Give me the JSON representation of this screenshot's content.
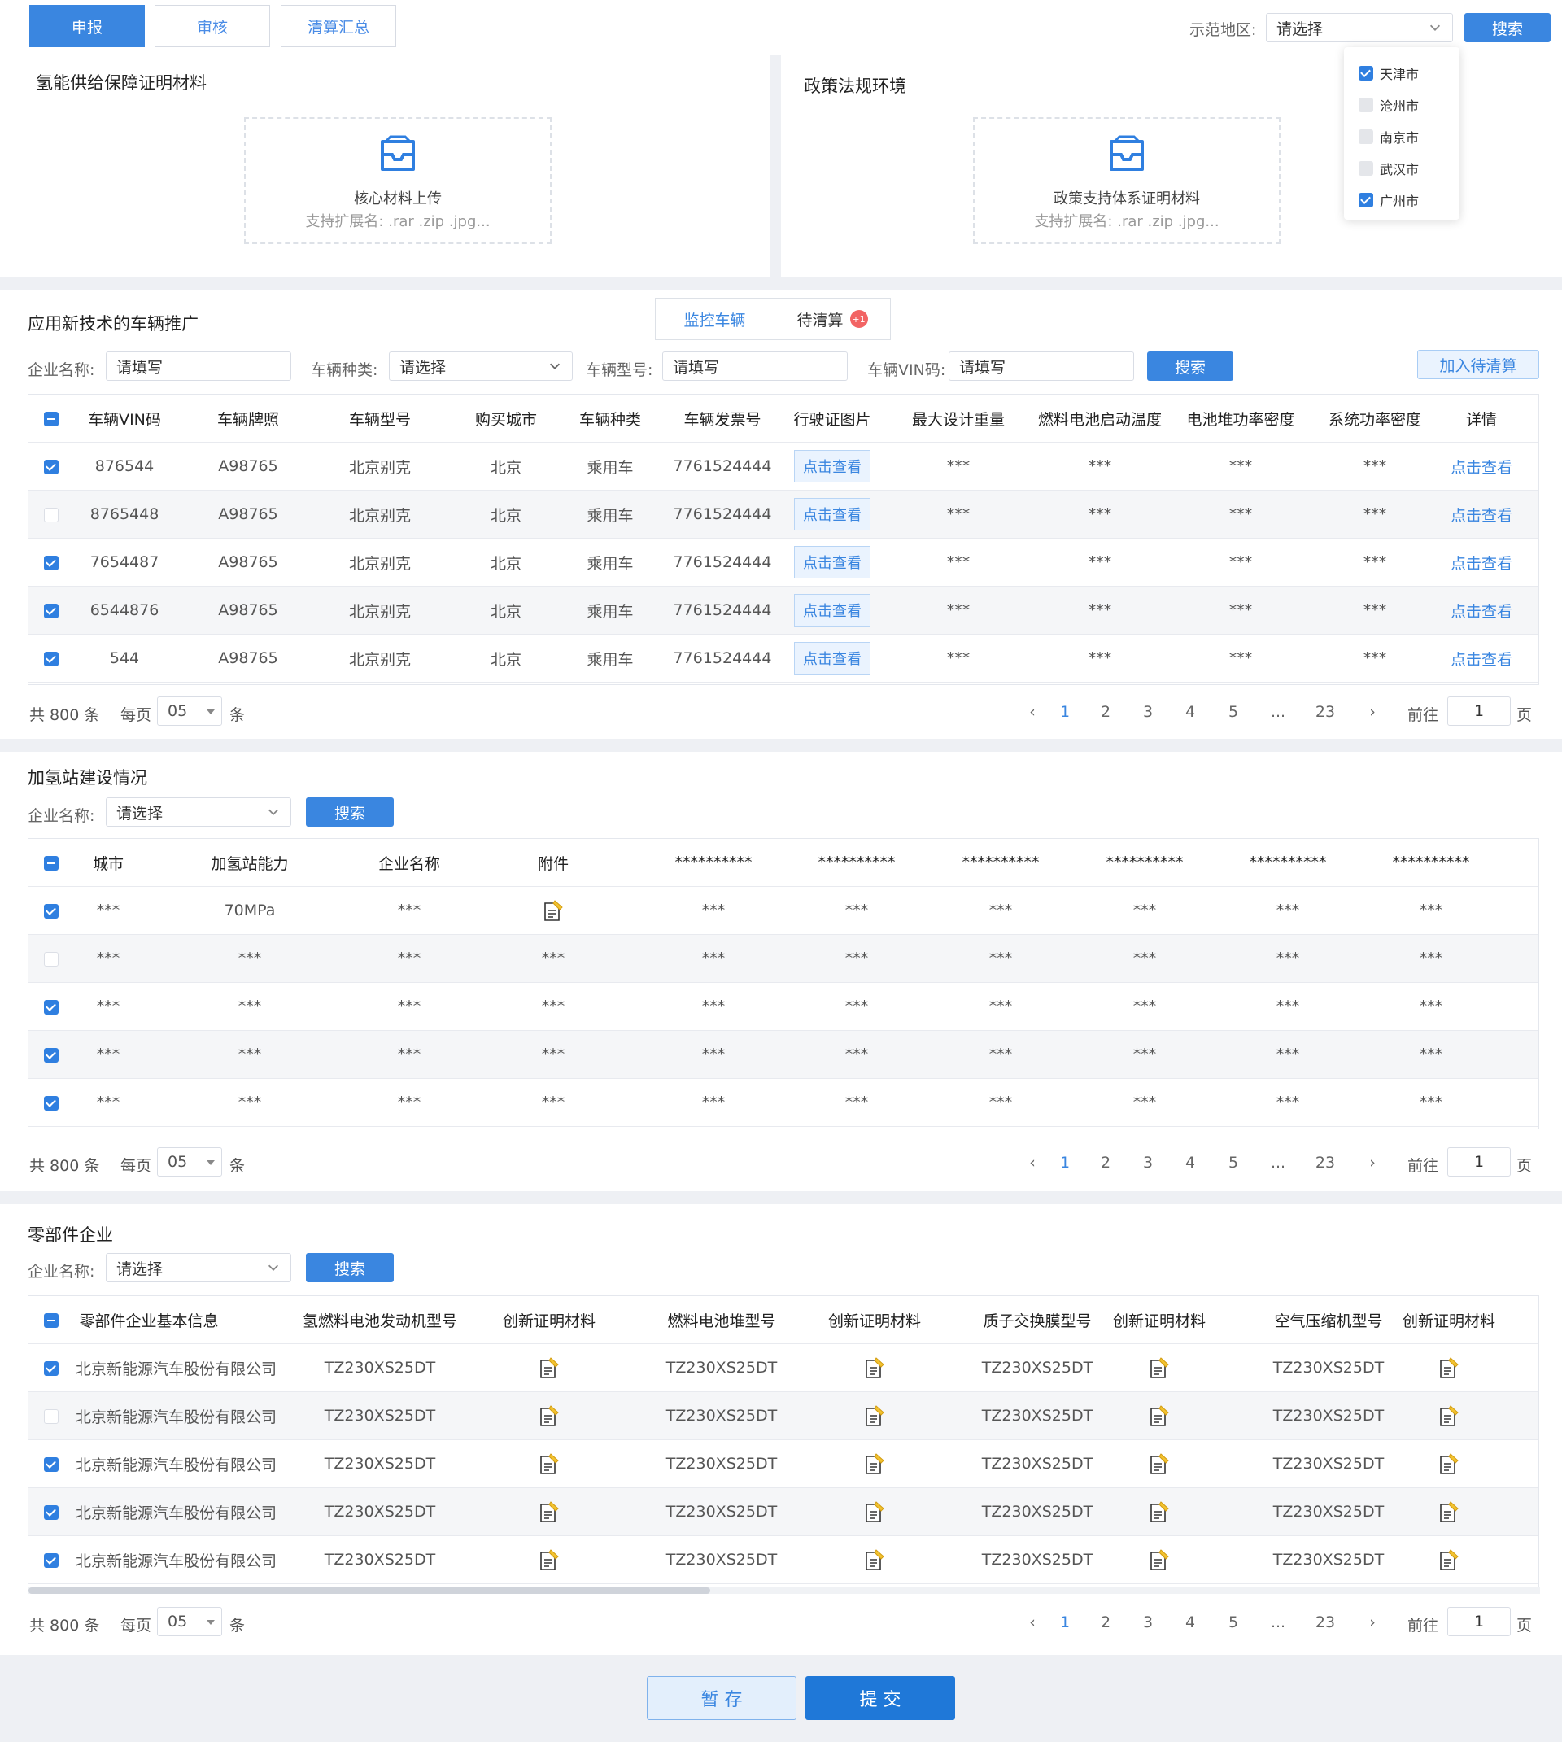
{
  "top_tabs": [
    "申报",
    "审核",
    "清算汇总"
  ],
  "region": {
    "label": "示范地区:",
    "placeholder": "请选择",
    "search": "搜索",
    "options": [
      {
        "name": "天津市",
        "checked": true
      },
      {
        "name": "沧州市",
        "checked": false
      },
      {
        "name": "南京市",
        "checked": false
      },
      {
        "name": "武汉市",
        "checked": false
      },
      {
        "name": "广州市",
        "checked": true
      }
    ]
  },
  "hydrogen": {
    "title": "氢能供给保障证明材料",
    "upload_title": "核心材料上传",
    "upload_hint": "支持扩展名: .rar .zip .jpg..."
  },
  "policy": {
    "title": "政策法规环境",
    "upload_title": "政策支持体系证明材料",
    "upload_hint": "支持扩展名: .rar .zip .jpg..."
  },
  "vehicle": {
    "title": "应用新技术的车辆推广",
    "tabs": [
      "监控车辆",
      "待清算"
    ],
    "badge": "+1",
    "filters": {
      "company_label": "企业名称:",
      "company_ph": "请填写",
      "type_label": "车辆种类:",
      "type_ph": "请选择",
      "model_label": "车辆型号:",
      "model_ph": "请填写",
      "vin_label": "车辆VIN码:",
      "vin_ph": "请填写",
      "search": "搜索",
      "add": "加入待清算"
    },
    "headers": [
      "车辆VIN码",
      "车辆牌照",
      "车辆型号",
      "购买城市",
      "车辆种类",
      "车辆发票号",
      "行驶证图片",
      "最大设计重量",
      "燃料电池启动温度",
      "电池堆功率密度",
      "系统功率密度",
      "详情"
    ],
    "view_label": "点击查看",
    "rows": [
      {
        "checked": true,
        "cells": [
          "876544",
          "A98765",
          "北京别克",
          "北京",
          "乘用车",
          "7761524444",
          "***",
          "***",
          "***",
          "***"
        ]
      },
      {
        "checked": false,
        "cells": [
          "8765448",
          "A98765",
          "北京别克",
          "北京",
          "乘用车",
          "7761524444",
          "***",
          "***",
          "***",
          "***"
        ]
      },
      {
        "checked": true,
        "cells": [
          "7654487",
          "A98765",
          "北京别克",
          "北京",
          "乘用车",
          "7761524444",
          "***",
          "***",
          "***",
          "***"
        ]
      },
      {
        "checked": true,
        "cells": [
          "6544876",
          "A98765",
          "北京别克",
          "北京",
          "乘用车",
          "7761524444",
          "***",
          "***",
          "***",
          "***"
        ]
      },
      {
        "checked": true,
        "cells": [
          "544",
          "A98765",
          "北京别克",
          "北京",
          "乘用车",
          "7761524444",
          "***",
          "***",
          "***",
          "***"
        ]
      }
    ]
  },
  "station": {
    "title": "加氢站建设情况",
    "company_label": "企业名称:",
    "company_ph": "请选择",
    "search": "搜索",
    "headers": [
      "城市",
      "加氢站能力",
      "企业名称",
      "附件",
      "**********",
      "**********",
      "**********",
      "**********",
      "**********",
      "**********"
    ],
    "rows": [
      {
        "checked": true,
        "cells": [
          "***",
          "70MPa",
          "***",
          "",
          "***",
          "***",
          "***",
          "***",
          "***",
          "***"
        ],
        "file": true
      },
      {
        "checked": false,
        "cells": [
          "***",
          "***",
          "***",
          "***",
          "***",
          "***",
          "***",
          "***",
          "***",
          "***"
        ],
        "file": false
      },
      {
        "checked": true,
        "cells": [
          "***",
          "***",
          "***",
          "***",
          "***",
          "***",
          "***",
          "***",
          "***",
          "***"
        ],
        "file": false
      },
      {
        "checked": true,
        "cells": [
          "***",
          "***",
          "***",
          "***",
          "***",
          "***",
          "***",
          "***",
          "***",
          "***"
        ],
        "file": false
      },
      {
        "checked": true,
        "cells": [
          "***",
          "***",
          "***",
          "***",
          "***",
          "***",
          "***",
          "***",
          "***",
          "***"
        ],
        "file": false
      }
    ]
  },
  "parts": {
    "title": "零部件企业",
    "company_label": "企业名称:",
    "company_ph": "请选择",
    "search": "搜索",
    "headers": [
      "零部件企业基本信息",
      "氢燃料电池发动机型号",
      "创新证明材料",
      "燃料电池堆型号",
      "创新证明材料",
      "质子交换膜型号",
      "创新证明材料",
      "空气压缩机型号",
      "创新证明材料"
    ],
    "rows": [
      {
        "checked": true,
        "company": "北京新能源汽车股份有限公司",
        "model": "TZ230XS25DT"
      },
      {
        "checked": false,
        "company": "北京新能源汽车股份有限公司",
        "model": "TZ230XS25DT"
      },
      {
        "checked": true,
        "company": "北京新能源汽车股份有限公司",
        "model": "TZ230XS25DT"
      },
      {
        "checked": true,
        "company": "北京新能源汽车股份有限公司",
        "model": "TZ230XS25DT"
      },
      {
        "checked": true,
        "company": "北京新能源汽车股份有限公司",
        "model": "TZ230XS25DT"
      }
    ]
  },
  "pager": {
    "total": "共 800 条",
    "per": "每页",
    "size": "05",
    "unit": "条",
    "pages": [
      "1",
      "2",
      "3",
      "4",
      "5",
      "...",
      "23"
    ],
    "goto": "前往",
    "goto_val": "1",
    "page": "页"
  },
  "footer": {
    "save": "暂 存",
    "submit": "提 交"
  }
}
